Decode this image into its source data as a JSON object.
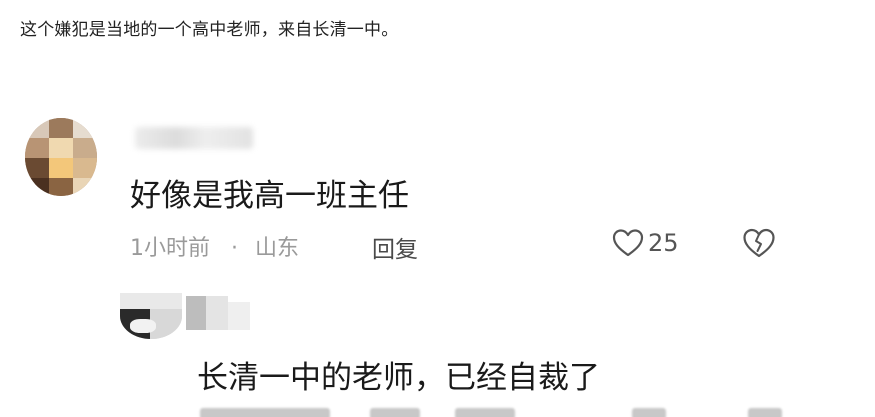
{
  "article": {
    "caption": "这个嫌犯是当地的一个高中老师，来自长清一中。"
  },
  "comments": [
    {
      "text": "好像是我高一班主任",
      "time": "1小时前",
      "separator": "·",
      "location": "山东",
      "reply_label": "回复",
      "likes": "25"
    },
    {
      "text": "长清一中的老师，已经自裁了"
    }
  ],
  "icons": {
    "like": "heart-outline-icon",
    "dislike": "broken-heart-icon"
  },
  "colors": {
    "text_primary": "#1a1a1a",
    "text_meta": "#9a9a9a",
    "icon": "#555555"
  }
}
